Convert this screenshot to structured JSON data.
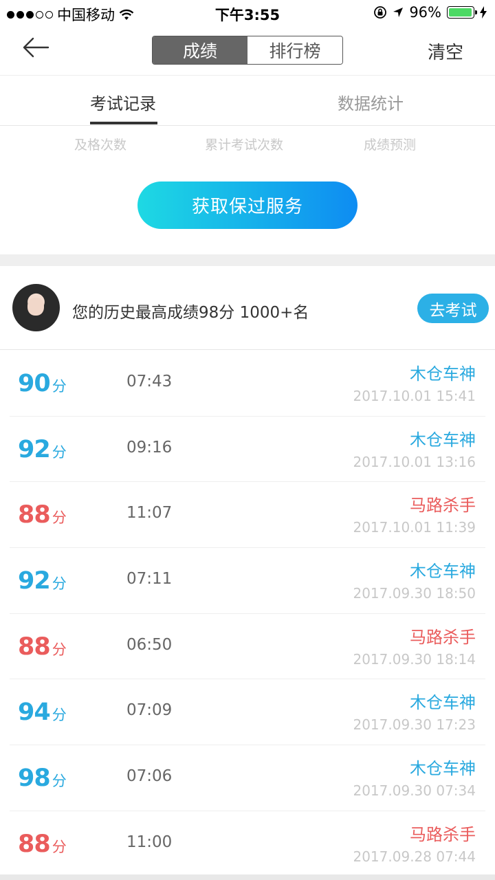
{
  "status_bar": {
    "carrier": "中国移动",
    "time": "下午3:55",
    "battery_percent": "96%",
    "battery_level": 0.96
  },
  "nav": {
    "segments": [
      "成绩",
      "排行榜"
    ],
    "active_segment": 0,
    "clear_label": "清空"
  },
  "sub_tabs": {
    "items": [
      "考试记录",
      "数据统计"
    ],
    "active": 0
  },
  "stats": {
    "labels": [
      "及格次数",
      "累计考试次数",
      "成绩预测"
    ]
  },
  "guarantee_button": "获取保过服务",
  "profile": {
    "best_text": "您的历史最高成绩98分 1000+名",
    "go_exam_label": "去考试"
  },
  "records": [
    {
      "score": "90",
      "unit": "分",
      "duration": "07:43",
      "title": "木仓车神",
      "date": "2017.10.01 15:41",
      "color": "#29a9df"
    },
    {
      "score": "92",
      "unit": "分",
      "duration": "09:16",
      "title": "木仓车神",
      "date": "2017.10.01 13:16",
      "color": "#29a9df"
    },
    {
      "score": "88",
      "unit": "分",
      "duration": "11:07",
      "title": "马路杀手",
      "date": "2017.10.01 11:39",
      "color": "#ea5c5c"
    },
    {
      "score": "92",
      "unit": "分",
      "duration": "07:11",
      "title": "木仓车神",
      "date": "2017.09.30 18:50",
      "color": "#29a9df"
    },
    {
      "score": "88",
      "unit": "分",
      "duration": "06:50",
      "title": "马路杀手",
      "date": "2017.09.30 18:14",
      "color": "#ea5c5c"
    },
    {
      "score": "94",
      "unit": "分",
      "duration": "07:09",
      "title": "木仓车神",
      "date": "2017.09.30 17:23",
      "color": "#29a9df"
    },
    {
      "score": "98",
      "unit": "分",
      "duration": "07:06",
      "title": "木仓车神",
      "date": "2017.09.30 07:34",
      "color": "#29a9df"
    },
    {
      "score": "88",
      "unit": "分",
      "duration": "11:00",
      "title": "马路杀手",
      "date": "2017.09.28 07:44",
      "color": "#ea5c5c"
    }
  ]
}
